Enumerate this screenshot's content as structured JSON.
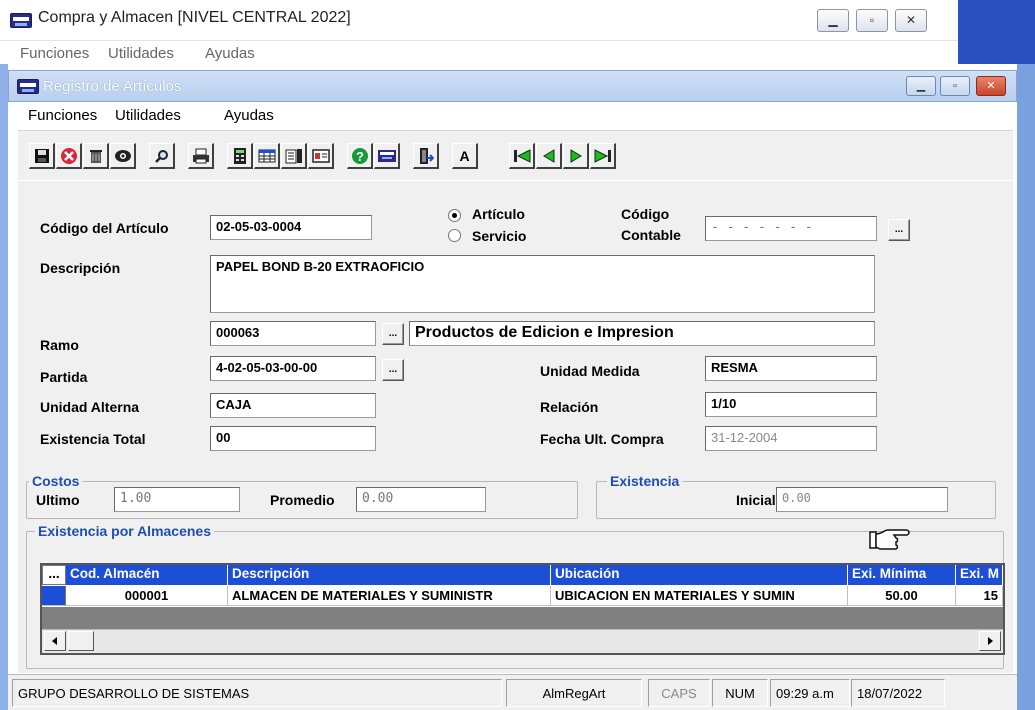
{
  "app": {
    "title": "Compra y Almacen [NIVEL CENTRAL 2022]",
    "menu": [
      "Funciones",
      "Utilidades",
      "Ayudas"
    ]
  },
  "child": {
    "title": "Registro de Artículos",
    "menu": [
      "Funciones",
      "Utilidades",
      "Ayudas"
    ]
  },
  "toolbar": {
    "font_button_label": "A"
  },
  "form": {
    "codigo_label": "Código del Artículo",
    "codigo_value": "02-05-03-0004",
    "tipo_options": [
      {
        "label": "Artículo",
        "selected": true
      },
      {
        "label": "Servicio",
        "selected": false
      }
    ],
    "codigo_contable_label_1": "Código",
    "codigo_contable_label_2": "Contable",
    "codigo_contable_value": "- - - - - - -",
    "descripcion_label": "Descripción",
    "descripcion_value": "PAPEL BOND B-20 EXTRAOFICIO",
    "ramo_label": "Ramo",
    "ramo_code": "000063",
    "ramo_desc": "Productos de Edicion e Impresion",
    "partida_label": "Partida",
    "partida_value": "4-02-05-03-00-00",
    "unidad_medida_label": "Unidad  Medida",
    "unidad_medida_value": "RESMA",
    "unidad_alterna_label": "Unidad Alterna",
    "unidad_alterna_value": "CAJA",
    "relacion_label": "Relación",
    "relacion_value": "1/10",
    "existencia_total_label": "Existencia Total",
    "existencia_total_value": "00",
    "fecha_label": "Fecha Ult. Compra",
    "fecha_value": "31-12-2004",
    "dots_label": "..."
  },
  "costos": {
    "title": "Costos",
    "ultimo_label": "Ultimo",
    "ultimo_value": "1.00",
    "promedio_label": "Promedio",
    "promedio_value": "0.00"
  },
  "existencia": {
    "title": "Existencia",
    "inicial_label": "Inicial",
    "inicial_value": "0.00"
  },
  "almacenes": {
    "title": "Existencia por Almacenes",
    "columns": [
      "Cod. Almacén",
      "Descripción",
      "Ubicación",
      "Exi. Mínima",
      "Exi. M"
    ],
    "rows": [
      [
        "000001",
        "ALMACEN DE MATERIALES Y SUMINISTR",
        "UBICACION EN MATERIALES Y SUMIN",
        "50.00",
        "15"
      ]
    ]
  },
  "status": {
    "company": "GRUPO DESARROLLO DE SISTEMAS",
    "form": "AlmRegArt",
    "caps": "CAPS",
    "num": "NUM",
    "time": "09:29 a.m",
    "date": "18/07/2022"
  },
  "colors": {
    "grid_header": "#1d4fd6",
    "group_title": "#1e4eb0",
    "outer_accent": "#2b51c1"
  }
}
